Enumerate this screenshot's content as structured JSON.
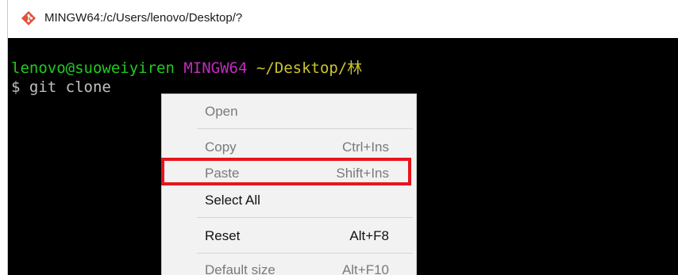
{
  "window": {
    "title": "MINGW64:/c/Users/lenovo/Desktop/?",
    "icon": "git-diamond-icon"
  },
  "terminal": {
    "prompt_user_host": "lenovo@suoweiyiren",
    "prompt_env": "MINGW64",
    "prompt_path": "~/Desktop/林",
    "command_line": "$ git clone",
    "colors": {
      "user_host": "#22c922",
      "env": "#c02cc0",
      "path": "#c9c42e",
      "text": "#c0c0c0"
    }
  },
  "context_menu": {
    "items": [
      {
        "label": "Open",
        "shortcut": "",
        "enabled": false
      },
      {
        "label": "Copy",
        "shortcut": "Ctrl+Ins",
        "enabled": false
      },
      {
        "label": "Paste",
        "shortcut": "Shift+Ins",
        "enabled": false
      },
      {
        "label": "Select All",
        "shortcut": "",
        "enabled": true
      },
      {
        "label": "Reset",
        "shortcut": "Alt+F8",
        "enabled": true
      },
      {
        "label": "Default size",
        "shortcut": "Alt+F10",
        "enabled": false
      }
    ]
  },
  "annotation": {
    "highlight_color": "#e8141c",
    "highlighted_item": "Paste"
  }
}
